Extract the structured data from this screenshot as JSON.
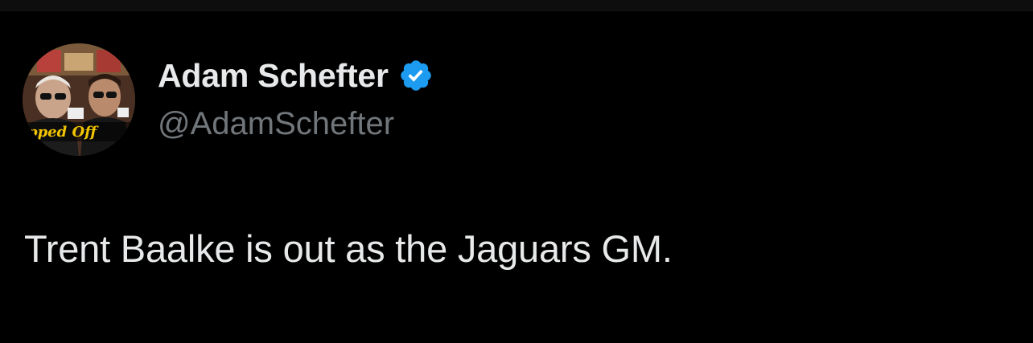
{
  "author": {
    "display_name": "Adam Schefter",
    "handle": "@AdamSchefter",
    "verified": true,
    "avatar_icon": "avatar-photo",
    "avatar_caption": "pped Off"
  },
  "tweet": {
    "text": "Trent Baalke is out as the Jaguars GM."
  },
  "colors": {
    "background": "#000000",
    "primary_text": "#e7e9ea",
    "secondary_text": "#71767b",
    "verified_blue": "#1d9bf0"
  }
}
